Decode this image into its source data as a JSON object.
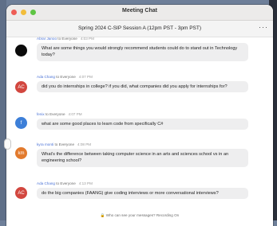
{
  "window": {
    "title": "Meeting Chat"
  },
  "session": {
    "title": "Spring 2024 C-SIP Session A (12pm PST - 3pm PST)",
    "more": "···"
  },
  "messages": [
    {
      "avatar_initials": "",
      "avatar_color": "#0b0b0b",
      "sender": "Abrar Janoo",
      "to": " to Everyone",
      "time": "4:03 PM",
      "text": "What are some things you would strongly recommend students could do to stand out in Technology today?"
    },
    {
      "avatar_initials": "AC",
      "avatar_color": "#d2473f",
      "sender": "Ada Chang",
      "to": " to Everyone",
      "time": "4:07 PM",
      "text": "did you do internships in college? if you did, what companies did you apply for internships for?"
    },
    {
      "avatar_initials": "f",
      "avatar_color": "#3d7fd8",
      "sender": "fenix",
      "to": " to Everyone",
      "time": "4:07 PM",
      "text": "what are some good places to learn code from specifically C#"
    },
    {
      "avatar_initials": "km",
      "avatar_color": "#e27a2d",
      "sender": "kyra monti",
      "to": " to Everyone",
      "time": "4:08 PM",
      "text": "What's the difference between taking computer science in an arts and sciences school vs in an engineering school?"
    },
    {
      "avatar_initials": "AC",
      "avatar_color": "#d2473f",
      "sender": "Ada Chang",
      "to": " to Everyone",
      "time": "4:13 PM",
      "text": "do the big companies (FAANG) give coding interviews or more conversational interviews?"
    }
  ],
  "footer": {
    "text": "Who can see your messages? Recording On"
  },
  "colors": {
    "sender": "#4a72d6",
    "bubble": "#eeeeef"
  }
}
